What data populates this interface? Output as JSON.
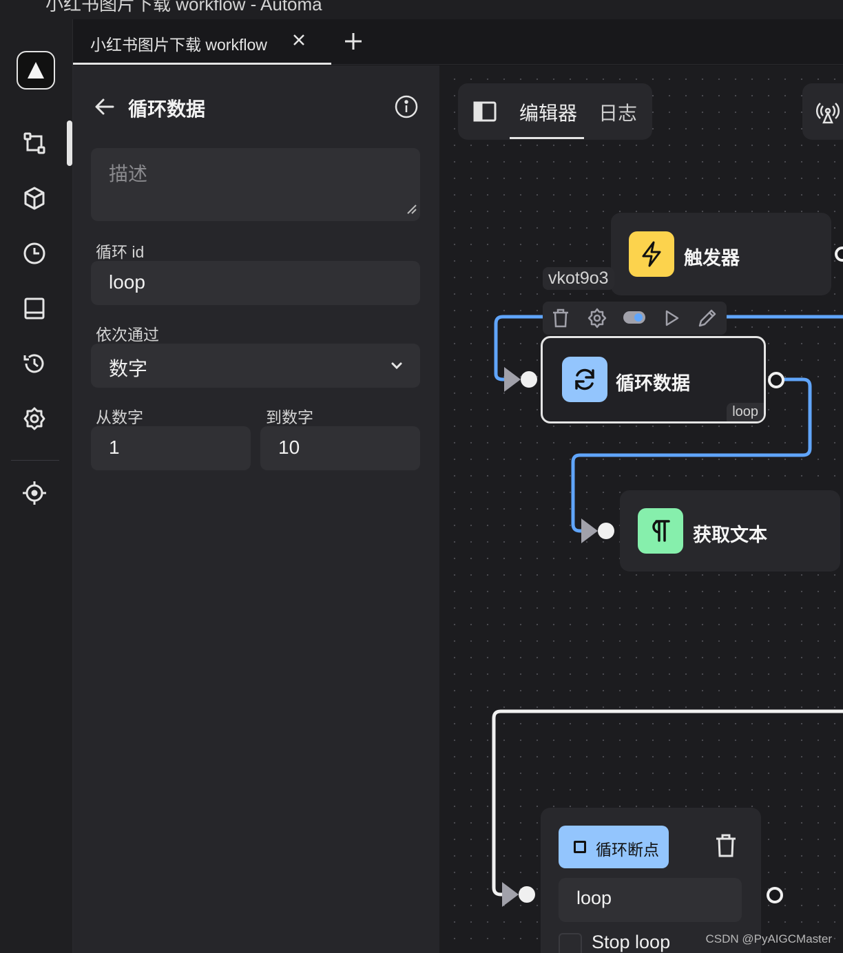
{
  "window": {
    "title": "小红书图片下载 workflow - Automa"
  },
  "tabs": [
    {
      "label": "小红书图片下载 workflow"
    }
  ],
  "panel": {
    "title": "循环数据",
    "description_placeholder": "描述",
    "loop_id_label": "循环 id",
    "loop_id_value": "loop",
    "loop_through_label": "依次通过",
    "loop_through_value": "数字",
    "from_label": "从数字",
    "from_value": "1",
    "to_label": "到数字",
    "to_value": "10"
  },
  "canvas": {
    "toolbar": {
      "editor_tab": "编辑器",
      "log_tab": "日志"
    },
    "trigger_node": {
      "label": "触发器"
    },
    "loop_node": {
      "id_tag": "vkot9o3",
      "label": "循环数据",
      "badge": "loop"
    },
    "text_node": {
      "label": "获取文本"
    },
    "breakpoint_node": {
      "button_label": "循环断点",
      "value": "loop",
      "stop_label": "Stop loop"
    }
  },
  "watermark": "CSDN @PyAIGCMaster",
  "colors": {
    "trigger": "#fcd34d",
    "loop": "#93c5fd",
    "text": "#86efac",
    "edge_blue": "#60a5fa",
    "edge_white": "#f0f0f0"
  }
}
